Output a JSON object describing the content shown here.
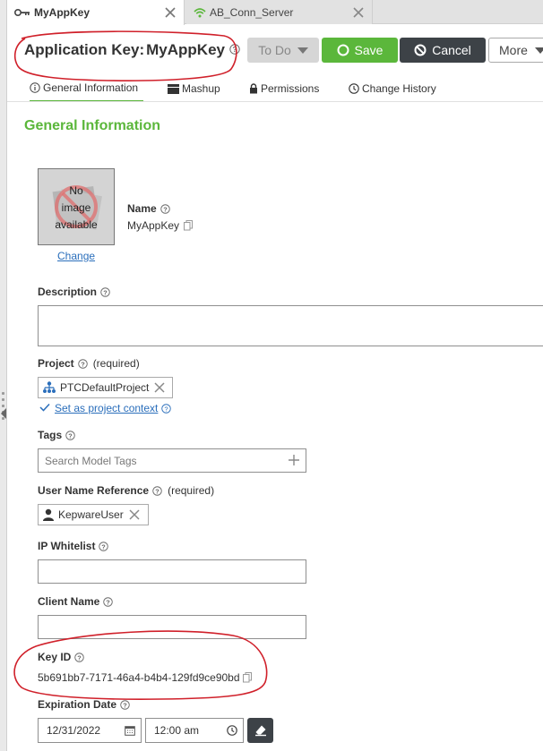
{
  "tabs": [
    {
      "label": "MyAppKey",
      "icon": "key-icon",
      "active": true
    },
    {
      "label": "AB_Conn_Server",
      "icon": "wifi-icon",
      "active": false
    }
  ],
  "header": {
    "title_prefix": "Application Key:",
    "title_name": "MyAppKey",
    "todo_label": "To Do",
    "save_label": "Save",
    "cancel_label": "Cancel",
    "more_label": "More"
  },
  "subtabs": [
    {
      "label": "General Information",
      "icon": "info-icon"
    },
    {
      "label": "Mashup",
      "icon": "mashup-icon"
    },
    {
      "label": "Permissions",
      "icon": "lock-icon"
    },
    {
      "label": "Change History",
      "icon": "clock-icon"
    }
  ],
  "main": {
    "section_title": "General Information",
    "image": {
      "line1": "No",
      "line2": "image",
      "line3": "available",
      "change_label": "Change"
    },
    "name": {
      "label": "Name",
      "value": "MyAppKey"
    },
    "description": {
      "label": "Description",
      "value": ""
    },
    "project": {
      "label": "Project",
      "required": "(required)",
      "value": "PTCDefaultProject",
      "context_label": "Set as project context"
    },
    "tags": {
      "label": "Tags",
      "placeholder": "Search Model Tags"
    },
    "user_name_reference": {
      "label": "User Name Reference",
      "required": "(required)",
      "value": "KepwareUser"
    },
    "ip_whitelist": {
      "label": "IP Whitelist",
      "value": ""
    },
    "client_name": {
      "label": "Client Name",
      "value": ""
    },
    "key_id": {
      "label": "Key ID",
      "value": "5b691bb7-7171-46a4-b4b4-129fd9ce90bd"
    },
    "expiration_date": {
      "label": "Expiration Date",
      "date": "12/31/2022",
      "time": "12:00 am"
    }
  },
  "colors": {
    "accent_green": "#5bb73b",
    "annotation_red": "#d0202a",
    "link_blue": "#2a6ebb",
    "dark_button": "#3d4247"
  }
}
